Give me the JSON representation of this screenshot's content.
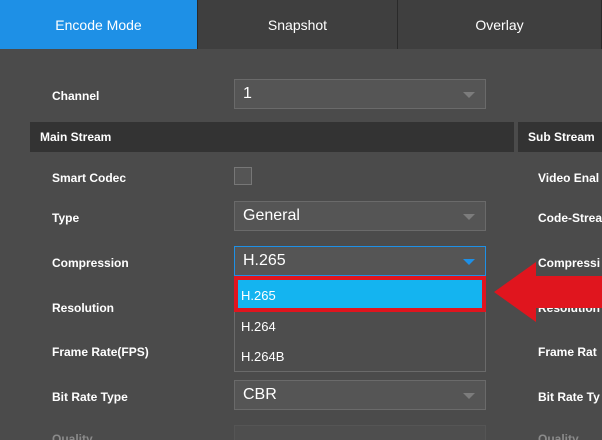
{
  "tabs": [
    {
      "label": "Encode Mode",
      "active": true
    },
    {
      "label": "Snapshot",
      "active": false
    },
    {
      "label": "Overlay",
      "active": false
    }
  ],
  "channel": {
    "label": "Channel",
    "value": "1"
  },
  "main_stream": {
    "title": "Main Stream",
    "fields": {
      "smart_codec": {
        "label": "Smart Codec",
        "checked": false
      },
      "type": {
        "label": "Type",
        "value": "General"
      },
      "compression": {
        "label": "Compression",
        "value": "H.265",
        "options": [
          "H.265",
          "H.264",
          "H.264B"
        ],
        "selected_index": 0
      },
      "resolution": {
        "label": "Resolution"
      },
      "frame_rate": {
        "label": "Frame Rate(FPS)"
      },
      "bit_rate_type": {
        "label": "Bit Rate Type",
        "value": "CBR"
      },
      "quality": {
        "label": "Quality"
      }
    }
  },
  "sub_stream": {
    "title": "Sub Stream",
    "labels": [
      "Video Enal",
      "Code-Strea",
      "Compressi",
      "Resolution",
      "Frame Rat",
      "Bit Rate Ty",
      "Quality"
    ]
  },
  "colors": {
    "accent": "#1e90e6",
    "selected": "#14b4f0",
    "highlight": "#e0151e"
  }
}
